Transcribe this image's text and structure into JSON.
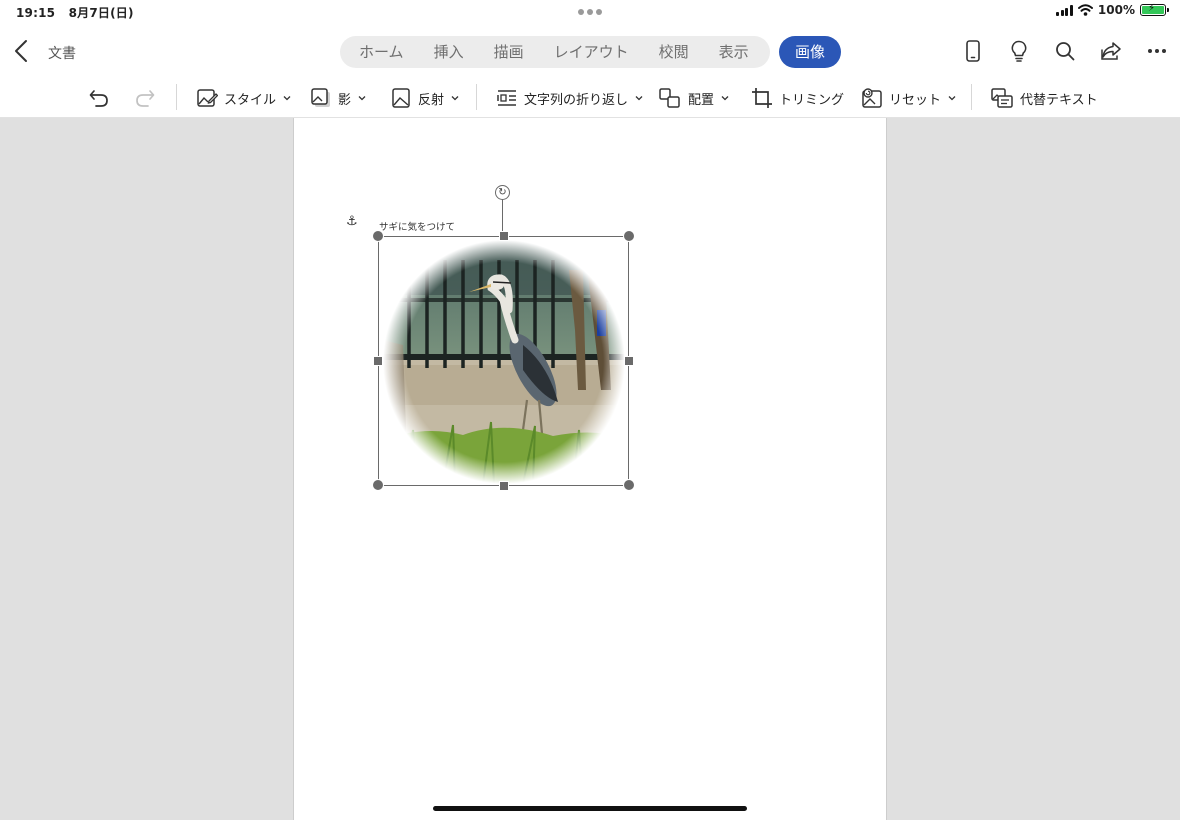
{
  "status": {
    "time": "19:15",
    "date": "8月7日(日)",
    "battery": "100%",
    "battery_level": 1.0
  },
  "top": {
    "doc_title": "文書",
    "tabs": [
      "ホーム",
      "挿入",
      "描画",
      "レイアウト",
      "校閲",
      "表示"
    ],
    "active_tab": "画像",
    "icons": [
      "phone-icon",
      "lightbulb-icon",
      "search-icon",
      "share-icon",
      "more-icon"
    ]
  },
  "ribbon": {
    "style": "スタイル",
    "shadow": "影",
    "reflection": "反射",
    "wrap_text": "文字列の折り返し",
    "arrange": "配置",
    "crop": "トリミング",
    "reset": "リセット",
    "alt_text": "代替テキスト"
  },
  "document": {
    "caption": "サギに気をつけて",
    "image_subject": "heron",
    "accent_color": "#2b57b7"
  }
}
